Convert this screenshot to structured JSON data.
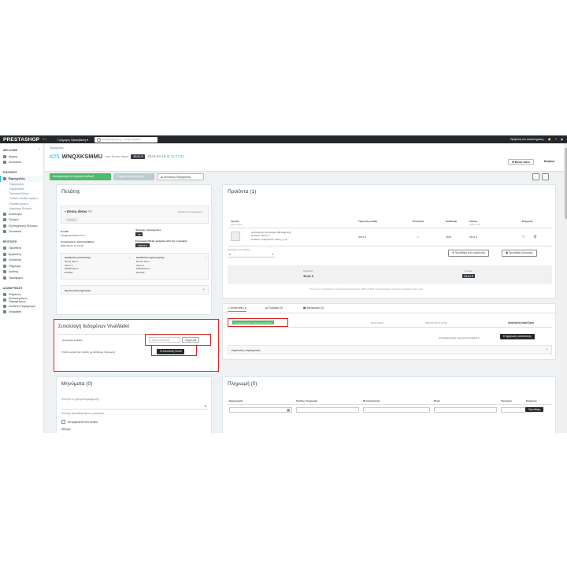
{
  "topbar": {
    "logo": "PRESTASHOP",
    "version": "8.1",
    "quick_access": "Γρήγορη Πρόσβαση ▾",
    "search_placeholder": "Αναζήτηση (π.χ.: όνομα προϊόν",
    "right_link": "Προβολή του καταστήματος"
  },
  "sidebar": {
    "collapse": "«",
    "sections": [
      {
        "title": "WELCOME",
        "items": [
          {
            "label": "Αρχική",
            "icon": "home-icon"
          },
          {
            "label": "Στατιστικά",
            "icon": "chart-icon"
          }
        ]
      },
      {
        "title": "ΠΩΛΗΣΕΙΣ",
        "items": [
          {
            "label": "Παραγγελίες",
            "icon": "cart-icon",
            "active": true,
            "subs": [
              "Παραγγελίες",
              "Παραστατικά",
              "Πιστωτικά δελτία",
              "Συνθέτε καλάθια αγορών",
              "Καλάθια Αγορών",
              "Μηνύματα Πελατών"
            ]
          },
          {
            "label": "Κατάλογος",
            "icon": "catalog-icon"
          },
          {
            "label": "Πελάτες",
            "icon": "customers-icon"
          },
          {
            "label": "Εξυπηρέτηση Πελατών",
            "icon": "support-icon"
          },
          {
            "label": "Στατιστικά",
            "icon": "stats-icon"
          }
        ]
      },
      {
        "title": "ΒΕΛΤΙΩΣΗ",
        "items": [
          {
            "label": "Πρόσθετα",
            "icon": "modules-icon"
          },
          {
            "label": "Εμφάνιση",
            "icon": "design-icon"
          },
          {
            "label": "Αποστολή",
            "icon": "shipping-icon"
          },
          {
            "label": "Πληρωμή",
            "icon": "payment-icon"
          },
          {
            "label": "Διεθνής",
            "icon": "globe-icon"
          },
          {
            "label": "Προσφορές",
            "icon": "promo-icon"
          }
        ]
      },
      {
        "title": "ΔΙΑΜΟΡΦΩΣΗ",
        "items": [
          {
            "label": "Ρυθμίσεις",
            "icon": "settings-icon"
          },
          {
            "label": "Καταστημάτων Παραμέτρους",
            "icon": "shop-params-icon"
          },
          {
            "label": "Σύνθετες Παράμετροι",
            "icon": "advanced-icon"
          },
          {
            "label": "Vivawallet",
            "icon": "viva-icon"
          }
        ]
      }
    ]
  },
  "header": {
    "breadcrumb": "Παραγγελίες",
    "order_number": "#25",
    "reference": "WNQXKSMMU",
    "from": "από Demo demo",
    "total": "35,61 €",
    "date": "2024-04-19",
    "time": "at 11:27:52",
    "boost_btn": "Boost sales",
    "help_btn": "Βοήθεια"
  },
  "status_bar": {
    "status": "Απομακρυσμένη πληρωμή αποδεκτή",
    "update_btn": "Ενημέρωση κατάστασης",
    "print_btn": "Εκτύπωση Παραγγελίας"
  },
  "customer": {
    "title": "Πελάτης",
    "name": "Demo demo",
    "id": "#3",
    "view_link": "Προβολή λεπτομερειών",
    "badge": "Πελάτης",
    "email_label": "E-mail:",
    "email": "info@foproprietor.com",
    "registered_label": "Λογαριασμός καταχωρήθηκε:",
    "registered": "2024-03-01 12:13:46",
    "valid_orders_label": "Έγκυρες παραγγελίες:",
    "valid_orders": "36",
    "total_spent_label": "Συνολικά ξόδεψε χρήματα από την εγγραφή:",
    "total_spent": "498,89 €",
    "shipping_label": "Διεύθυνση αποστολής:",
    "shipping": [
      "Demo demo",
      "demo 1",
      "54648 Demo",
      "Ελλάδα"
    ],
    "invoice_label": "Διεύθυνση τιμολόγησης:",
    "invoice": [
      "Demo demo",
      "demo 1",
      "54648 Demo",
      "Ελλάδα"
    ],
    "private_note": "Προσωπική σημείωση"
  },
  "viva": {
    "title": "Συναλλαγή δεδομένων VivaWallet",
    "code_label": "Αντιγραφή κωδικόυ",
    "code_placeholder": "d0f5b0a9cb8fb0d",
    "copy_btn": "Copy Link",
    "send_label": "Στείλτε email στον πελάτη με σύνδεσμο πληρωμής",
    "send_btn": "Αποστολή Email"
  },
  "messages": {
    "title": "Μηνύματα (0)",
    "choose": "Επιλέξτε το μήνυμα διαμόρφωσης",
    "template_hint": "Επιλογή προκαθορισμένου μηνύματος",
    "checkbox_label": "Να εμφανιστεί στον πελάτη",
    "message_label": "Μήνυμα"
  },
  "products": {
    "title": "Προϊόντα (1)",
    "columns": [
      "προϊόν",
      "Τιμή ανά μονάδα",
      "Ποσότητα",
      "Διαθέσιμο",
      "Σύνολο",
      "Ενέργειες"
    ],
    "col_sub": [
      "φόρος συμπ.",
      "",
      "",
      "",
      "φόρος συμπ.",
      ""
    ],
    "rows": [
      {
        "name": "Ημιπαράχτο Ξενοδοχείο (Μετάφραση)",
        "ref": "Κωδικός: demo_1",
        "supplier": "Κωδικός προμηθευτή: demo_1_s2",
        "price": "35,61 €",
        "qty": "1",
        "stock": "1508",
        "total": "35,61 €"
      }
    ],
    "per_page": "Προϊόντα ανά σελίδα",
    "per_page_value": "8",
    "add_btn": "Προσθήκη ενός προϊόντος",
    "discount_btn": "Προσθήκη έκπτωσης",
    "products_label": "Προϊόντα",
    "products_value": "35,61 €",
    "total_label": "Σύνολο",
    "total_value": "35,61 €",
    "tax_note": "Για αυτήν την παραγγελία η τιμή καταγράφηκε(συμπεριλ. ΦΠΑ) 24 ΦΠΑ. Ορισμός βασικών πολιτικών συναλλαγών αξιών μετά."
  },
  "history": {
    "tabs": [
      "Κατάσταση (1)",
      "Έγγραφα (0)",
      "Μεταφορείς (0)"
    ],
    "status": "Απομακρυσμένη πληρωμή αποδεκτή",
    "employee": "Demo Demo",
    "datetime": "2024-04-19 11:27:52",
    "resend": "Αποστολή email ξανά",
    "select": "Απομακρυσμένη πληρωμή αποδεκτή",
    "update_btn": "Ενημέρωση κατάστασης",
    "notes": "Σημειώσεις παραγγελίας"
  },
  "payment": {
    "title": "Πληρωμή (0)",
    "columns": [
      "Ημερομηνία",
      "Τρόπος πληρωμής",
      "ID συναλλαγής",
      "Ποσό",
      "Τιμολόγιο",
      "Ενέργειες"
    ],
    "add_btn": "Προσθήκη"
  },
  "colors": {
    "accent": "#25b9d7",
    "status_green": "#4cbb6c",
    "dark": "#25282b",
    "highlight_red": "#dd2222"
  }
}
